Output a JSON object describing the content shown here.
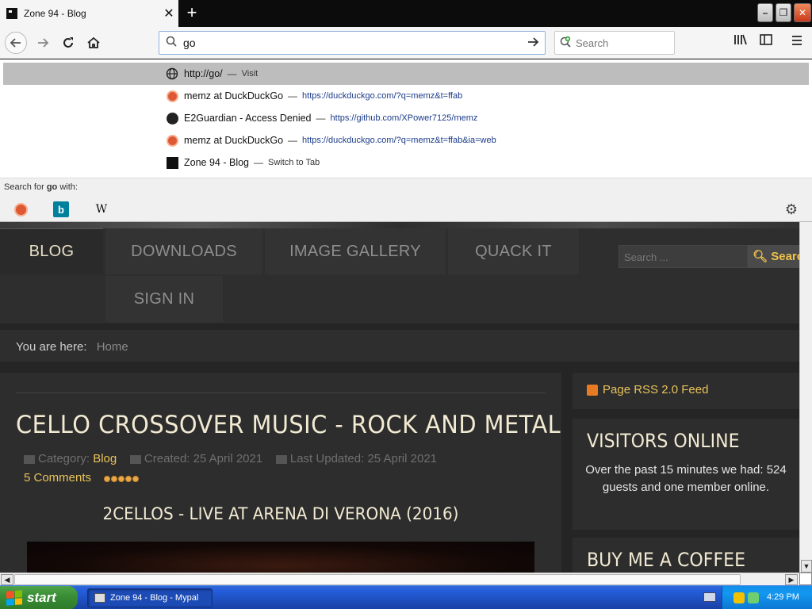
{
  "browser": {
    "tab_title": "Zone 94 - Blog",
    "tab_close": "✕",
    "new_tab": "+",
    "url_text": "go",
    "search_placeholder": "Search"
  },
  "dropdown": {
    "rows": [
      {
        "title": "http://go/",
        "sep": "—",
        "action": "Visit",
        "url": "",
        "icon": "globe-icon"
      },
      {
        "title": "memz at DuckDuckGo",
        "sep": "—",
        "url": "https://duckduckgo.com/?q=memz&t=ffab",
        "action": "",
        "icon": "duckduckgo-icon"
      },
      {
        "title": "E2Guardian - Access Denied",
        "sep": "—",
        "url": "https://github.com/XPower7125/memz",
        "action": "",
        "icon": "github-icon"
      },
      {
        "title": "memz at DuckDuckGo",
        "sep": "—",
        "url": "https://duckduckgo.com/?q=memz&t=ffab&ia=web",
        "action": "",
        "icon": "duckduckgo-icon"
      },
      {
        "title": "Zone 94 - Blog",
        "sep": "—",
        "action": "Switch to Tab",
        "url": "",
        "icon": "zone94-icon"
      }
    ],
    "search_with_prefix": "Search for ",
    "search_with_term": "go",
    "search_with_suffix": " with:",
    "engines": [
      "duckduckgo-icon",
      "bing-icon",
      "wikipedia-icon"
    ],
    "bing_glyph": "b",
    "wiki_glyph": "W"
  },
  "site": {
    "menu": {
      "items": [
        "BLOG",
        "DOWNLOADS",
        "IMAGE GALLERY",
        "QUACK IT",
        "SIGN IN"
      ],
      "active": "BLOG"
    },
    "search_placeholder": "Search ...",
    "search_button": "Search",
    "breadcrumb": {
      "label": "You are here:",
      "home": "Home"
    },
    "article": {
      "title": "CELLO CROSSOVER MUSIC - ROCK AND METAL",
      "category_label": "Category:",
      "category": "Blog",
      "created": "Created: 25 April 2021",
      "updated": "Last Updated: 25 April 2021",
      "comments": "5 Comments",
      "rating": 5,
      "video_title": "2CELLOS - LIVE AT ARENA DI VERONA (2016)"
    },
    "sidebar": {
      "rss": "Page RSS 2.0 Feed",
      "visitors_title": "VISITORS ONLINE",
      "visitors_text": "Over the past 15 minutes we had: 524 guests and one member online.",
      "coffee_title": "BUY ME A COFFEE"
    }
  },
  "taskbar": {
    "start": "start",
    "task": "Zone 94 - Blog - Mypal",
    "clock": "4:29 PM"
  },
  "colors": {
    "accent_gold": "#e8c35a",
    "heading": "#f2ead2",
    "page_bg": "#252525"
  }
}
